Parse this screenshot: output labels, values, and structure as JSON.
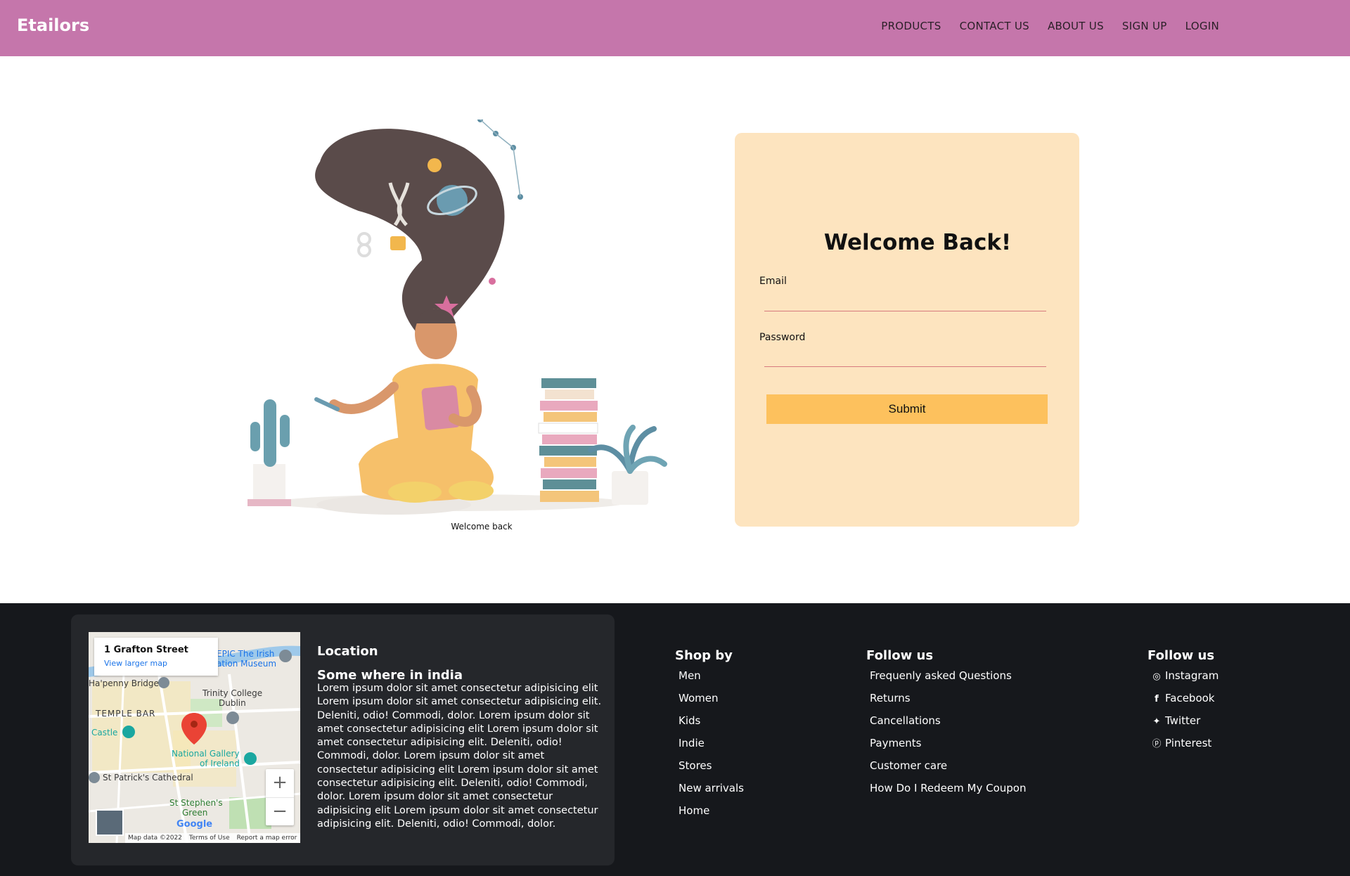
{
  "navbar": {
    "brand": "Etailors",
    "links": [
      "PRODUCTS",
      "CONTACT US",
      "ABOUT US",
      "SIGN UP",
      "LOGIN"
    ],
    "background": "#c576ab"
  },
  "hero": {
    "caption": "Welcome back"
  },
  "login": {
    "title": "Welcome Back!",
    "email_label": "Email",
    "password_label": "Password",
    "submit_label": "Submit",
    "card_color": "#fde4bf",
    "button_color": "#fdc15d"
  },
  "footer": {
    "map": {
      "address": "1 Grafton Street",
      "larger_map": "View larger map",
      "labels": [
        "EPIC The Irish",
        "ation Museum",
        "Ha'penny Bridge",
        "Trinity College",
        "Dublin",
        "TEMPLE BAR",
        "Castle",
        "National Gallery",
        "of Ireland",
        "St Patrick's Cathedral",
        "St Stephen's",
        "Green"
      ],
      "attribution": [
        "Map data ©2022",
        "Terms of Use",
        "Report a map error"
      ],
      "google": "Google",
      "zoom_in": "+",
      "zoom_out": "−"
    },
    "location": {
      "heading": "Location",
      "subheading": "Some where in india",
      "body": "Lorem ipsum dolor sit amet consectetur adipisicing elit Lorem ipsum dolor sit amet consectetur adipisicing elit. Deleniti, odio! Commodi, dolor. Lorem ipsum dolor sit amet consectetur adipisicing elit Lorem ipsum dolor sit amet consectetur adipisicing elit. Deleniti, odio! Commodi, dolor. Lorem ipsum dolor sit amet consectetur adipisicing elit Lorem ipsum dolor sit amet consectetur adipisicing elit. Deleniti, odio! Commodi, dolor. Lorem ipsum dolor sit amet consectetur adipisicing elit Lorem ipsum dolor sit amet consectetur adipisicing elit. Deleniti, odio! Commodi, dolor."
    },
    "shop": {
      "heading": "Shop by",
      "items": [
        "Men",
        "Women",
        "Kids",
        "Indie",
        "Stores",
        "New arrivals",
        "Home"
      ]
    },
    "help": {
      "heading": "Follow us",
      "items": [
        "Frequenly asked Questions",
        "Returns",
        "Cancellations",
        "Payments",
        "Customer care",
        "How Do I Redeem My Coupon"
      ]
    },
    "social": {
      "heading": "Follow us",
      "items": [
        {
          "icon": "instagram-icon",
          "label": "Instagram"
        },
        {
          "icon": "facebook-icon",
          "label": "Facebook"
        },
        {
          "icon": "twitter-icon",
          "label": "Twitter"
        },
        {
          "icon": "pinterest-icon",
          "label": "Pinterest"
        }
      ]
    },
    "background": "#16181c"
  }
}
